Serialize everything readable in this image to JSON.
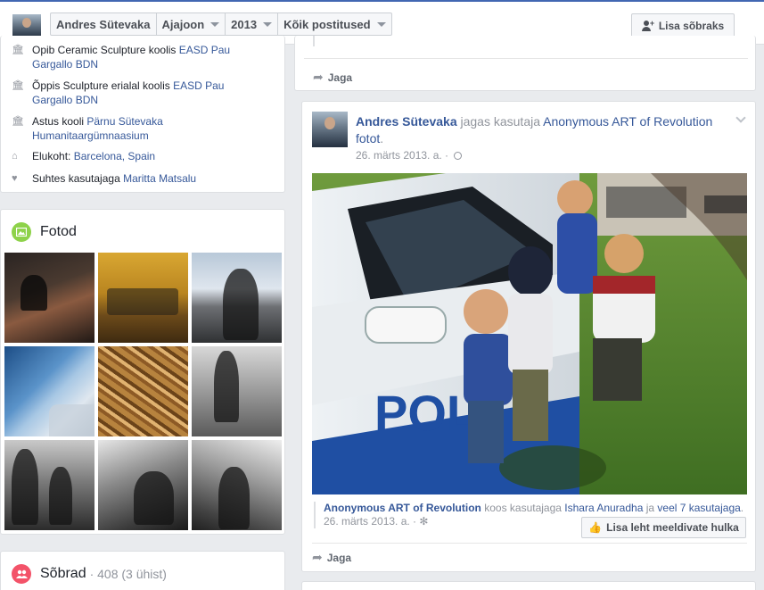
{
  "topbar": {
    "filters": [
      "Andres Sütevaka",
      "Ajajoon",
      "2013",
      "Kõik postitused"
    ],
    "add_friend_label": "Lisa sõbraks"
  },
  "about": {
    "items": [
      {
        "icon": "school-icon",
        "text": "Opib Ceramic Sculpture koolis ",
        "link": "EASD Pau Gargallo BDN"
      },
      {
        "icon": "school-icon",
        "text": "Õppis Sculpture erialal koolis ",
        "link": "EASD Pau Gargallo BDN"
      },
      {
        "icon": "school-icon",
        "text": "Astus kooli ",
        "link": "Pärnu Sütevaka Humanitaargümnaasium"
      },
      {
        "icon": "home-icon",
        "text": "Elukoht: ",
        "link": "Barcelona, Spain"
      },
      {
        "icon": "heart-icon",
        "text": "Suhtes kasutajaga ",
        "link": "Maritta Matsalu"
      }
    ]
  },
  "photos": {
    "title": "Fotod"
  },
  "friends": {
    "title": "Sõbrad",
    "count": "· 408 (3 ühist)"
  },
  "share_label": "Jaga",
  "post": {
    "author": "Andres Sütevaka",
    "action": " jagas kasutaja ",
    "page": "Anonymous ART of Revolution",
    "object": "fotot",
    "object_suffix": ".",
    "time": "26. märts 2013. a. ·",
    "attribution": {
      "page": "Anonymous ART of Revolution",
      "with_text": " koos kasutajaga ",
      "person": "Ishara Anuradha",
      "and_text": " ja ",
      "others": "veel 7 kasutajaga",
      "suffix": ".",
      "time": "26. märts 2013. a. ·"
    },
    "like_page_label": "Lisa leht meeldivate hulka",
    "car_text": "POLI"
  }
}
